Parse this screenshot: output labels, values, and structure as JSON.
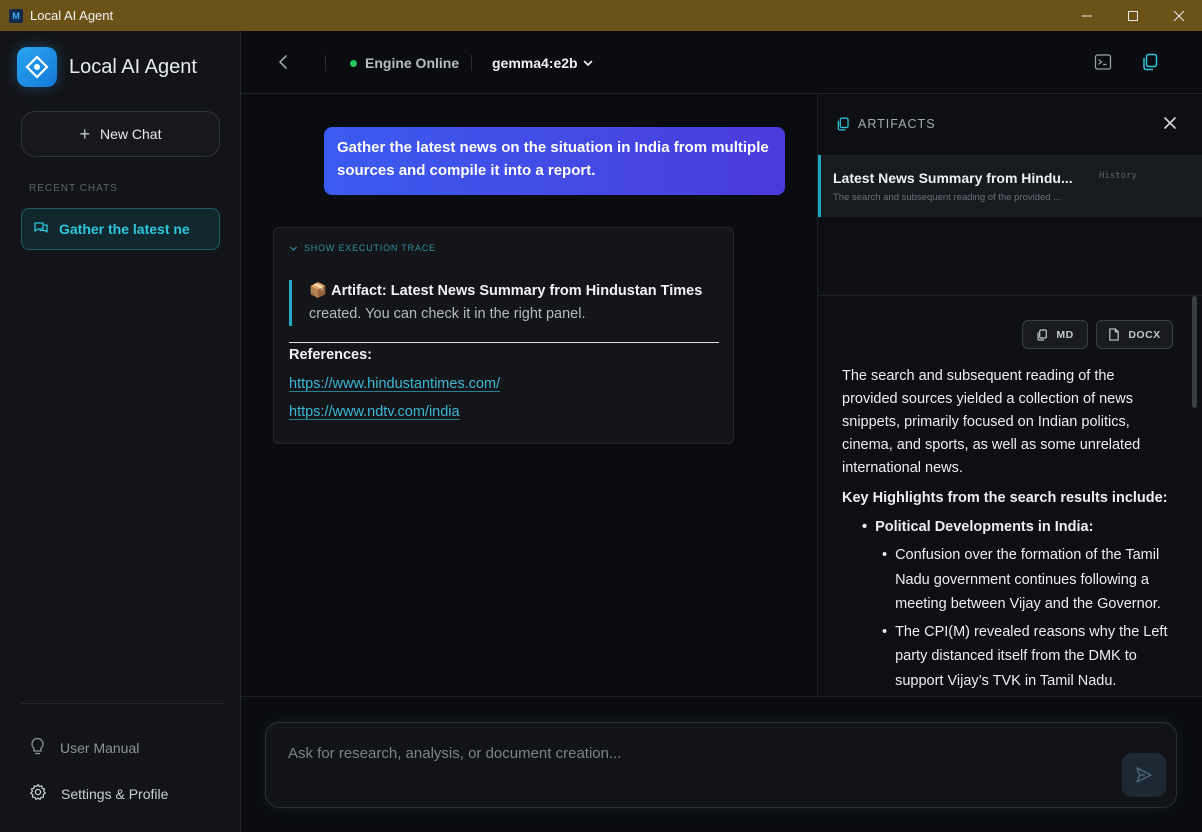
{
  "window": {
    "title": "Local AI Agent",
    "app_icon_letter": "M"
  },
  "sidebar": {
    "brand": "Local AI Agent",
    "new_chat_label": "New Chat",
    "recent_label": "RECENT CHATS",
    "chats": [
      {
        "label": "Gather the latest ne",
        "active": true
      }
    ],
    "user_manual_label": "User Manual",
    "settings_label": "Settings & Profile"
  },
  "topbar": {
    "engine_status": "Engine Online",
    "model": "gemma4:e2b"
  },
  "chat": {
    "user_message": "Gather the latest news on the situation in India from multiple sources and compile it into a report.",
    "trace_toggle": "SHOW EXECUTION TRACE",
    "artifact_emoji": "📦",
    "artifact_title": "Artifact: Latest News Summary from Hindustan Times",
    "artifact_note": "created. You can check it in the right panel.",
    "references_title": "References:",
    "references": [
      "https://www.hindustantimes.com/",
      "https://www.ndtv.com/india"
    ]
  },
  "input": {
    "placeholder": "Ask for research, analysis, or document creation..."
  },
  "artifacts": {
    "header": "ARTIFACTS",
    "items": [
      {
        "title": "Latest News Summary from Hindu...",
        "subtitle": "The search and subsequent reading of the provided ...",
        "tag": "History"
      }
    ],
    "download_md": "MD",
    "download_docx": "DOCX",
    "content": {
      "intro": "The search and subsequent reading of the provided sources yielded a collection of news snippets, primarily focused on Indian politics, cinema, and sports, as well as some unrelated international news.",
      "highlights_heading": "Key Highlights from the search results include:",
      "section_1": "Political Developments in India:",
      "bullets": [
        "Confusion over the formation of the Tamil Nadu government continues following a meeting between Vijay and the Governor.",
        "The CPI(M) revealed reasons why the Left party distanced itself from the DMK to support Vijay’s TVK in Tamil Nadu."
      ]
    }
  },
  "colors": {
    "accent": "#2ec5dd",
    "online": "#22c55e",
    "titlebar": "#6b5318"
  }
}
